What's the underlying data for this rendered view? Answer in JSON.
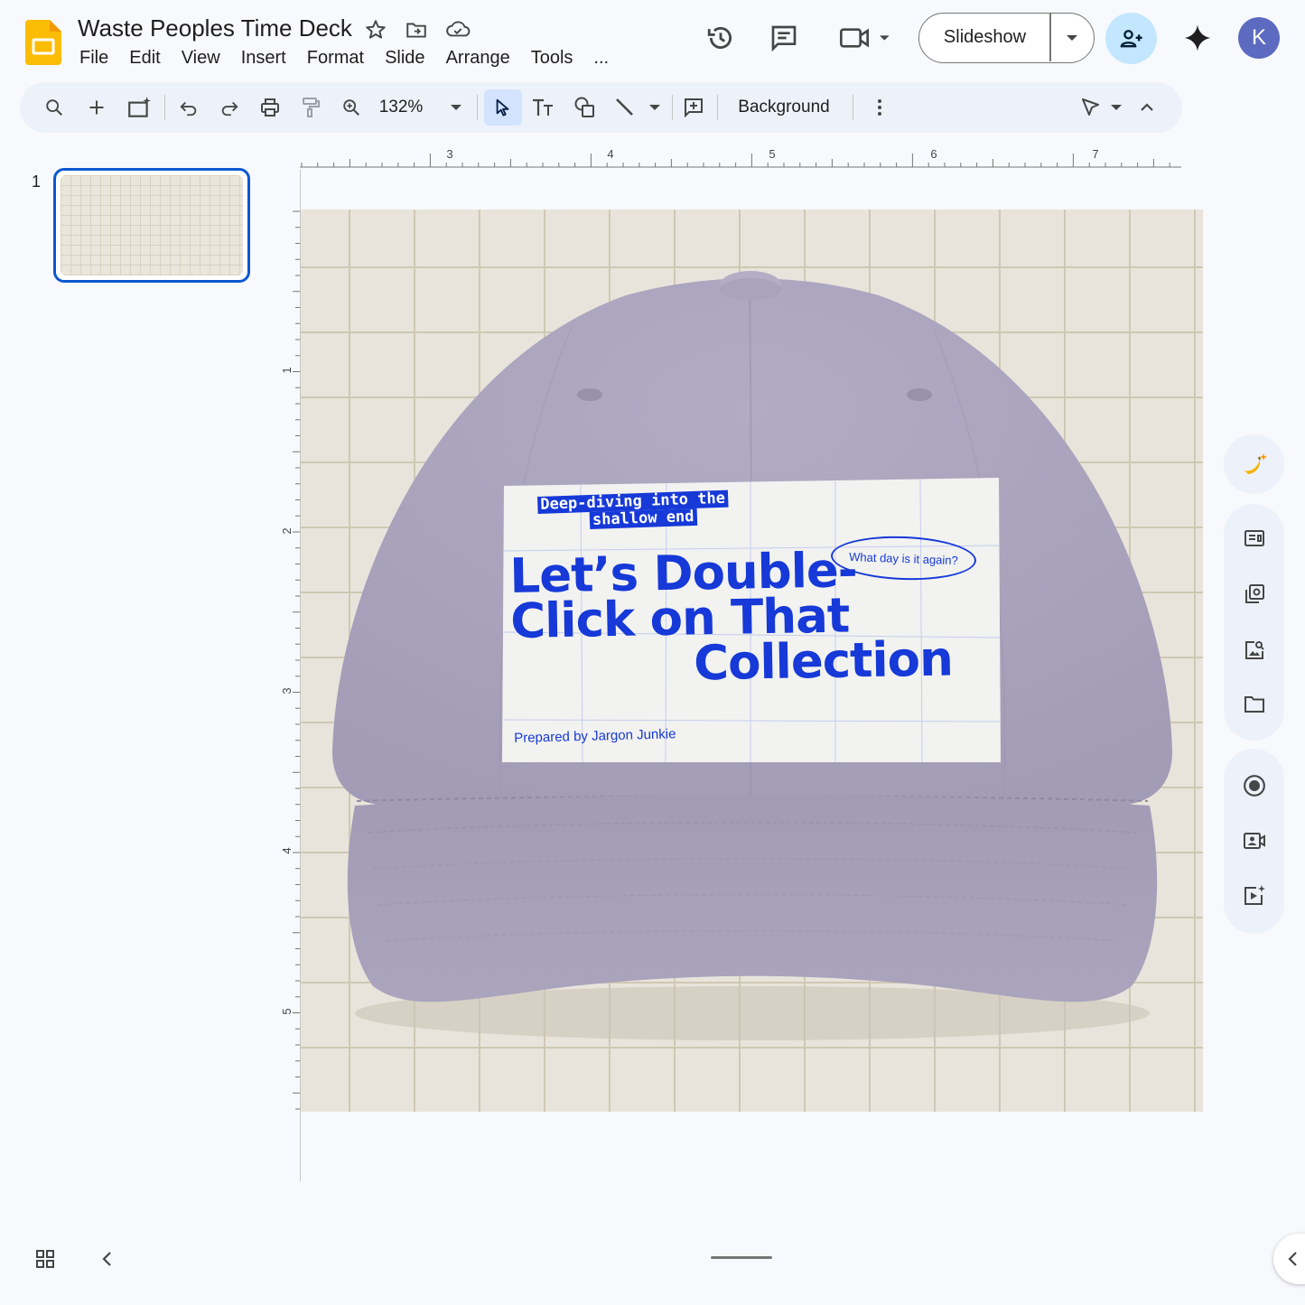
{
  "app": {
    "title": "Waste Peoples Time Deck",
    "icons": [
      "slides-logo-icon",
      "star-icon",
      "move-folder-icon",
      "cloud-saved-icon"
    ]
  },
  "menu": [
    "File",
    "Edit",
    "View",
    "Insert",
    "Format",
    "Slide",
    "Arrange",
    "Tools",
    "..."
  ],
  "header": {
    "slideshow_label": "Slideshow",
    "avatar_letter": "K",
    "icons": [
      "version-history-icon",
      "comments-icon",
      "meet-camera-icon",
      "share-person-add-icon",
      "gemini-sparkle-icon"
    ]
  },
  "toolbar": {
    "zoom": "132%",
    "background_label": "Background",
    "icons": [
      "search-icon",
      "plus-icon",
      "new-slide-icon",
      "undo-icon",
      "redo-icon",
      "print-icon",
      "paint-format-icon",
      "zoom-icon",
      "select-arrow-icon",
      "text-box-icon",
      "shapes-icon",
      "line-icon",
      "add-comment-icon",
      "more-vert-icon",
      "pointer-mode-icon",
      "collapse-toolbar-icon"
    ]
  },
  "filmstrip": {
    "slides": [
      {
        "number": "1",
        "selected": true
      }
    ]
  },
  "ruler": {
    "top_labels": [
      "3",
      "4",
      "5",
      "6",
      "7"
    ],
    "left_labels": [
      "1",
      "2",
      "3",
      "4",
      "5"
    ]
  },
  "slide": {
    "background": "#e8e4db",
    "hat_color": "#a9a3bd",
    "label_color": "#1639d8",
    "subtitle_line1": "Deep-diving into the",
    "subtitle_line2": "shallow end",
    "title_line1": "Let’s Double-",
    "title_line2": "Click on That",
    "title_line3": "Collection",
    "oval_text": "What day is it again?",
    "author": "Prepared by Jargon Junkie"
  },
  "side_panel": {
    "icons": [
      "banana-sparkle-icon",
      "text-panel-icon",
      "copy-slides-icon",
      "image-search-icon",
      "folder-icon",
      "record-icon",
      "camera-record-icon",
      "video-sparkle-icon"
    ]
  },
  "bottom": {
    "icons": [
      "grid-view-icon",
      "chevron-left-icon",
      "chevron-left-expand-icon"
    ]
  }
}
